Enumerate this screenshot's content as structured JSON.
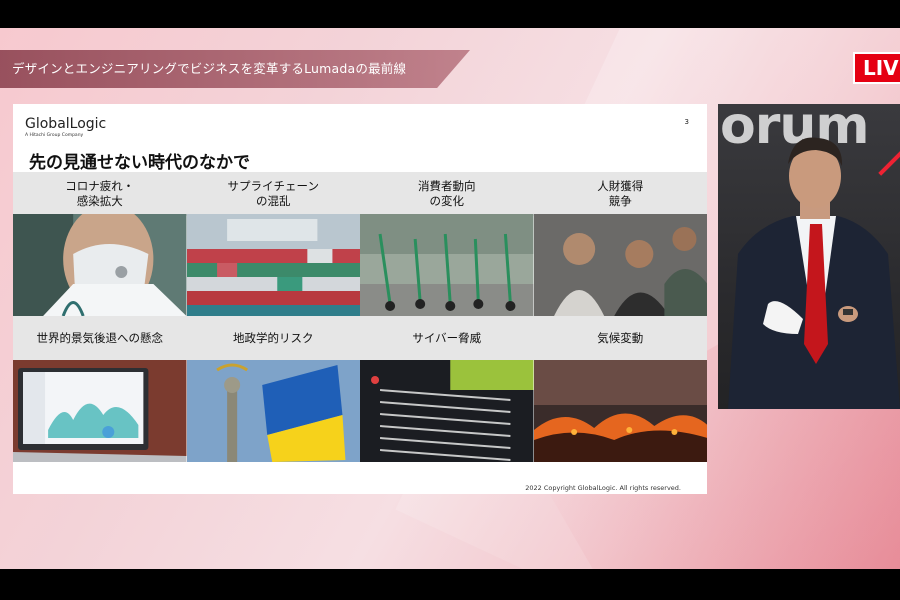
{
  "header": {
    "title": "デザインとエンジニアリングでビジネスを変革するLumadaの最前線",
    "live_label": "LIVE"
  },
  "slide": {
    "logo_main": "GlobalLogic",
    "logo_sub": "A Hitachi Group Company",
    "page_number": "3",
    "heading": "先の見通せない時代のなかで",
    "categories_row1": [
      "コロナ疲れ・\n感染拡大",
      "サプライチェーン\nの混乱",
      "消費者動向\nの変化",
      "人財獲得\n競争"
    ],
    "categories_row2": [
      "世界的景気後退への懸念",
      "地政学的リスク",
      "サイバー脅威",
      "気候変動"
    ],
    "copyright": "2022 Copyright GlobalLogic. All rights reserved."
  },
  "camera": {
    "backdrop_text": "orum"
  },
  "colors": {
    "live_red": "#e50012",
    "tie_red": "#c4161c"
  }
}
